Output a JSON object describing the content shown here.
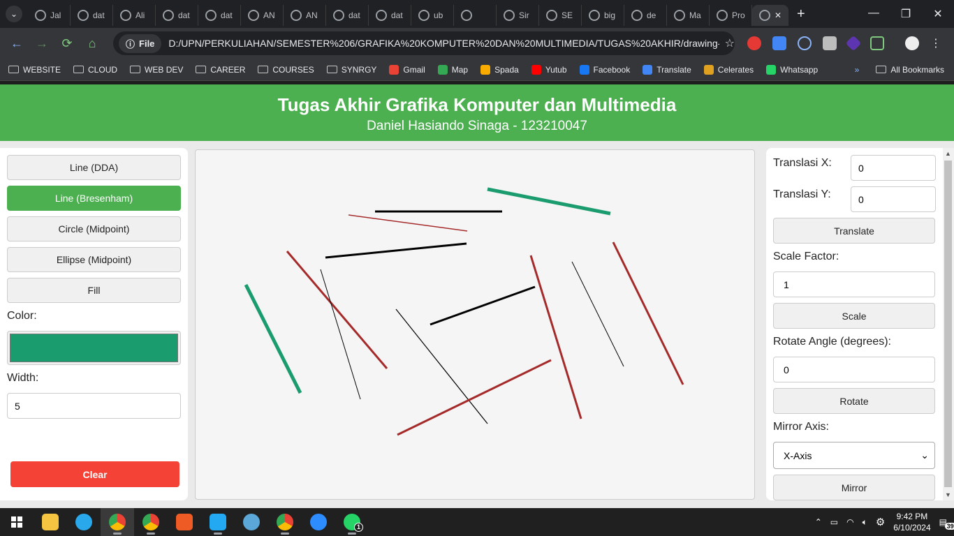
{
  "browser": {
    "tabs": [
      {
        "label": "Jal"
      },
      {
        "label": "dat"
      },
      {
        "label": "Ali"
      },
      {
        "label": "dat"
      },
      {
        "label": "dat"
      },
      {
        "label": "AN"
      },
      {
        "label": "AN"
      },
      {
        "label": "dat"
      },
      {
        "label": "dat"
      },
      {
        "label": "ub"
      },
      {
        "label": ""
      },
      {
        "label": "Sir"
      },
      {
        "label": "SE"
      },
      {
        "label": "big"
      },
      {
        "label": "de"
      },
      {
        "label": "Ma"
      },
      {
        "label": "Pro"
      }
    ],
    "url_chip": "File",
    "url": "D:/UPN/PERKULIAHAN/SEMESTER%206/GRAFIKA%20KOMPUTER%20DAN%20MULTIMEDIA/TUGAS%20AKHIR/drawing-web/i...",
    "bookmarks": [
      "WEBSITE",
      "CLOUD",
      "WEB DEV",
      "CAREER",
      "COURSES",
      "SYNRGY",
      "Gmail",
      "Map",
      "Spada",
      "Yutub",
      "Facebook",
      "Translate",
      "Celerates",
      "Whatsapp"
    ],
    "more_bookmarks": "»",
    "all_bookmarks": "All Bookmarks"
  },
  "header": {
    "title": "Tugas Akhir Grafika Komputer dan Multimedia",
    "subtitle": "Daniel Hasiando Sinaga - 123210047"
  },
  "tools": {
    "dda": "Line (DDA)",
    "bresenham": "Line (Bresenham)",
    "circle": "Circle (Midpoint)",
    "ellipse": "Ellipse (Midpoint)",
    "fill": "Fill",
    "color_label": "Color:",
    "color_value": "#1b9c6e",
    "width_label": "Width:",
    "width_value": "5",
    "clear": "Clear"
  },
  "transform": {
    "tx_label": "Translasi X:",
    "tx_value": "0",
    "ty_label": "Translasi Y:",
    "ty_value": "0",
    "translate": "Translate",
    "scale_label": "Scale Factor:",
    "scale_value": "1",
    "scale": "Scale",
    "rotate_label": "Rotate Angle (degrees):",
    "rotate_value": "0",
    "rotate": "Rotate",
    "mirror_label": "Mirror Axis:",
    "mirror_value": "X-Axis",
    "mirror": "Mirror"
  },
  "taskbar": {
    "time": "9:42 PM",
    "date": "6/10/2024",
    "notifications": "39",
    "whatsapp_badge": "1"
  }
}
